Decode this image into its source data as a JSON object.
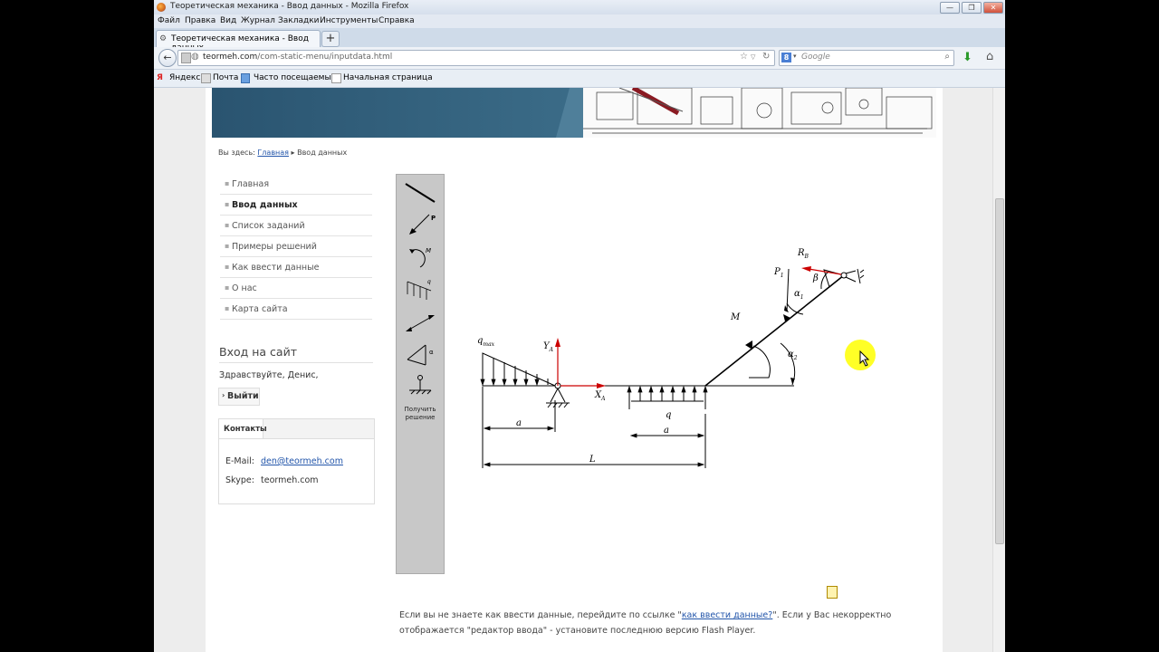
{
  "window": {
    "title": "Теоретическая механика - Ввод данных - Mozilla Firefox",
    "controls": [
      "—",
      "❐",
      "✕"
    ]
  },
  "menu": [
    "Файл",
    "Правка",
    "Вид",
    "Журнал",
    "Закладки",
    "Инструменты",
    "Справка"
  ],
  "tab": {
    "label": "Теоретическая механика - Ввод данных",
    "new_tab": "+"
  },
  "nav": {
    "back": "←",
    "url_host": "teormeh.com",
    "url_path": "/com-static-menu/inputdata.html",
    "search_engine": "8",
    "search_placeholder": "Google",
    "icons": [
      "star-icon",
      "reload-icon",
      "download-icon",
      "home-icon"
    ]
  },
  "bookmarks": [
    "Яндекс",
    "Почта",
    "Часто посещаемые",
    "Начальная страница"
  ],
  "breadcrumb": {
    "prefix": "Вы здесь:",
    "home": "Главная",
    "sep": "▸",
    "current": "Ввод данных"
  },
  "sidebar": {
    "items": [
      {
        "label": "Главная"
      },
      {
        "label": "Ввод данных"
      },
      {
        "label": "Список заданий"
      },
      {
        "label": "Примеры решений"
      },
      {
        "label": "Как ввести данные"
      },
      {
        "label": "О нас"
      },
      {
        "label": "Карта сайта"
      }
    ],
    "active": 1
  },
  "login": {
    "heading": "Вход на сайт",
    "greeting": "Здравствуйте, Денис,",
    "logout": "Выйти"
  },
  "contacts": {
    "tab": "Контакты",
    "email_label": "E-Mail:",
    "email": "den@teormeh.com",
    "skype_label": "Skype:",
    "skype": "teormeh.com"
  },
  "tools": {
    "items": [
      "rod-tool",
      "force-tool",
      "moment-tool",
      "distributed-load-tool",
      "dimension-tool",
      "angle-tool",
      "support-tool"
    ],
    "labels": {
      "force": "P",
      "moment": "M",
      "load": "q",
      "angle": "α"
    },
    "solve_label_1": "Получить",
    "solve_label_2": "решение"
  },
  "diagram": {
    "labels": {
      "qmax": "q",
      "qmax_sub": "max",
      "ya": "Y",
      "ya_sub": "A",
      "xa": "X",
      "xa_sub": "A",
      "q": "q",
      "a1": "a",
      "a2": "a",
      "L": "L",
      "M": "M",
      "P1": "P",
      "P1_sub": "1",
      "RB": "R",
      "RB_sub": "B",
      "alpha1": "α",
      "alpha1_sub": "1",
      "alpha2": "α",
      "alpha2_sub": "2",
      "beta": "β"
    }
  },
  "note": {
    "text1": "Если вы не знаете как ввести данные, перейдите по ссылке \"",
    "link": "как ввести данные?",
    "text2": "\". Если у Вас некорректно отображается \"редактор ввода\" - установите последнюю версию Flash Player."
  }
}
